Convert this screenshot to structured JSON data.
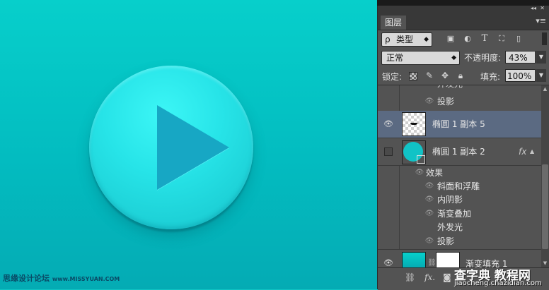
{
  "panel": {
    "tab_title": "图层",
    "menu_icon": "panel-menu-icon",
    "filter": {
      "prefix": "ρ",
      "kind": "类型",
      "arrow": "◆"
    },
    "blend": {
      "mode": "正常",
      "arrow": "◆"
    },
    "opacity": {
      "label": "不透明度:",
      "value": "43%"
    },
    "lock": {
      "label": "锁定:"
    },
    "fill": {
      "label": "填充:",
      "value": "100%"
    }
  },
  "layers": {
    "partial_top": {
      "text": "外发光"
    },
    "shadow_top": {
      "text": "投影"
    },
    "selected": {
      "name": "椭圆 1 副本 5"
    },
    "layer2": {
      "name": "椭圆 1 副本 2",
      "fx": "fx"
    },
    "effects_header": "效果",
    "effects": [
      "斜面和浮雕",
      "内阴影",
      "渐变叠加",
      "外发光",
      "投影"
    ],
    "gradient_fill": {
      "name": "渐变填充 1"
    }
  },
  "footer": {
    "fx": "fx."
  },
  "watermark": {
    "left_title": "思缘设计论坛",
    "left_site": "www.MISSYUAN.COM",
    "right_title": "查字典 教程网",
    "right_url": "jiaocheng.chazidian.com"
  },
  "colors": {
    "canvas_top": "#07cfcb",
    "canvas_bottom": "#04abb4",
    "circle": "#27e4e8",
    "play_triangle": "#17a7c4",
    "panel_bg": "#535353",
    "selected_row": "#5b6a82"
  }
}
